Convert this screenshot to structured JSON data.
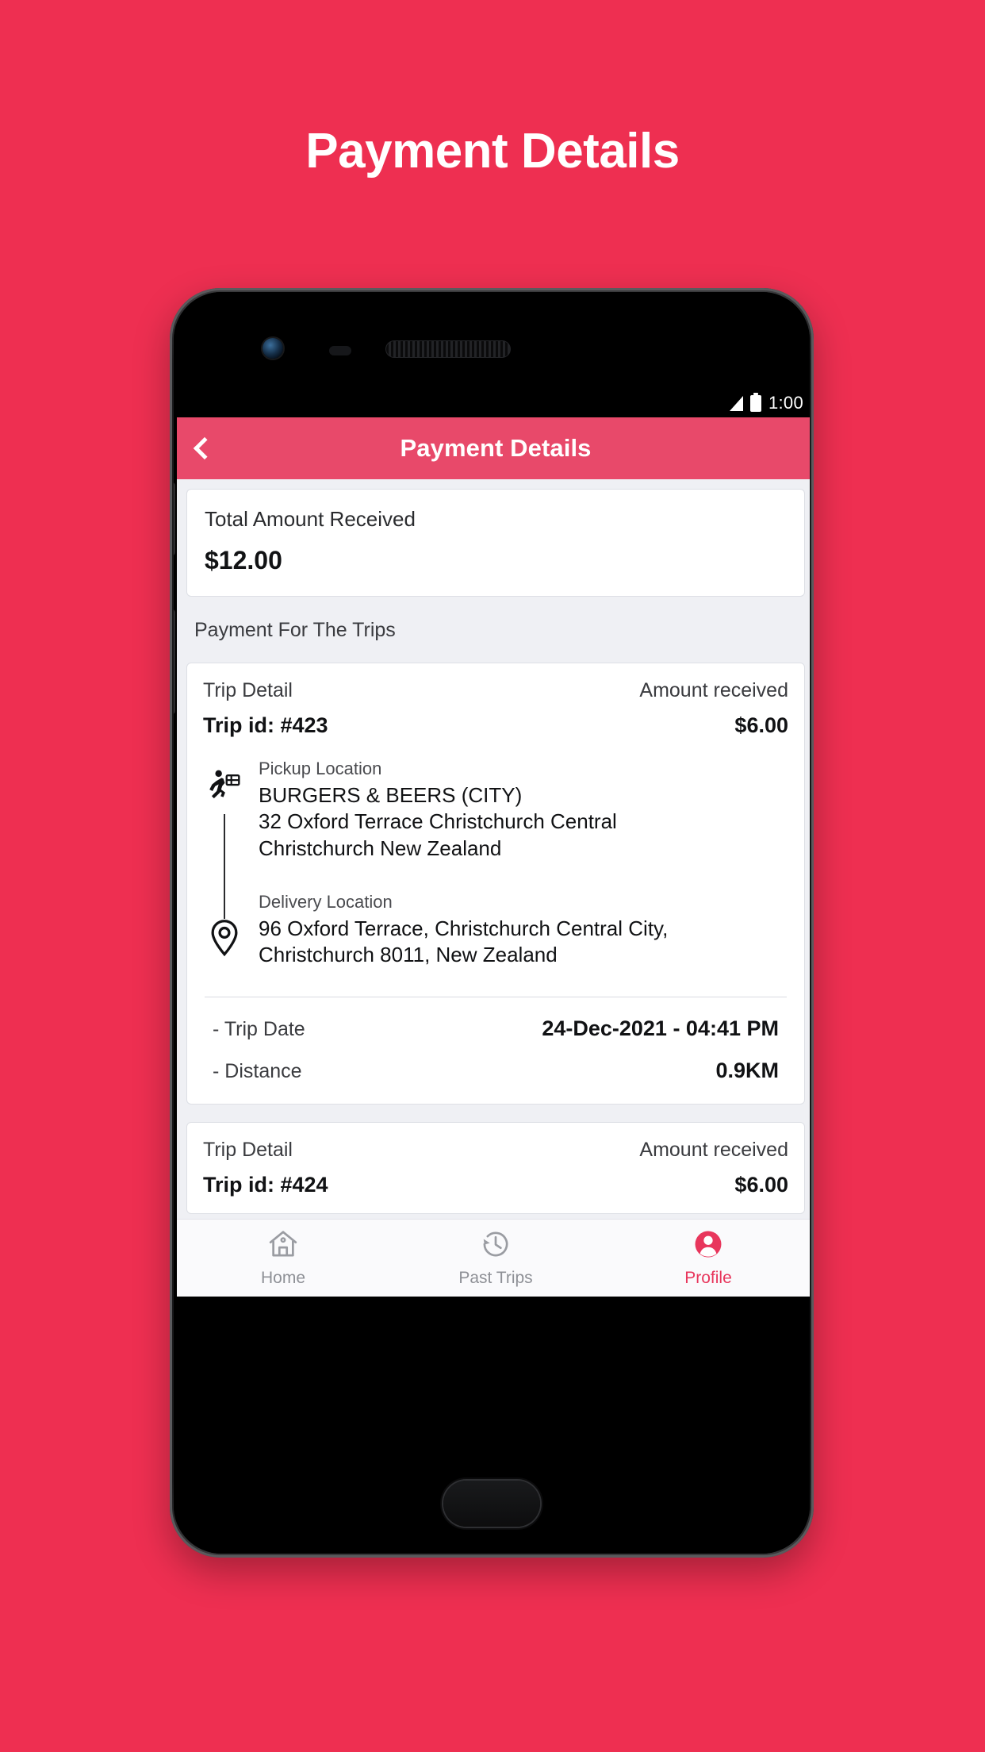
{
  "page": {
    "title": "Payment Details",
    "background_color": "#ee2f51",
    "accent_color": "#e8496a"
  },
  "status_bar": {
    "time": "1:00",
    "signal_icon": "signal-icon",
    "battery_icon": "battery-icon"
  },
  "app_bar": {
    "back_icon": "chevron-left-icon",
    "title": "Payment Details"
  },
  "total": {
    "label": "Total Amount Received",
    "value": "$12.00"
  },
  "section": {
    "label": "Payment For The Trips"
  },
  "trips": [
    {
      "detail_label": "Trip Detail",
      "amount_label": "Amount received",
      "trip_id": "Trip id: #423",
      "amount": "$6.00",
      "pickup": {
        "icon": "courier-running-icon",
        "label": "Pickup Location",
        "name": "BURGERS & BEERS (CITY)",
        "address_line_1": "32 Oxford Terrace  Christchurch Central",
        "address_line_2": "Christchurch  New Zealand"
      },
      "delivery": {
        "icon": "map-pin-icon",
        "label": "Delivery Location",
        "address_line_1": "96 Oxford Terrace, Christchurch Central City,",
        "address_line_2": "Christchurch 8011, New Zealand"
      },
      "trip_date_key": "- Trip Date",
      "trip_date_value": "24-Dec-2021 - 04:41 PM",
      "distance_key": "- Distance",
      "distance_value": "0.9KM"
    },
    {
      "detail_label": "Trip Detail",
      "amount_label": "Amount received",
      "trip_id": "Trip id: #424",
      "amount": "$6.00"
    }
  ],
  "bottom_nav": [
    {
      "label": "Home",
      "icon": "home-icon",
      "active": false
    },
    {
      "label": "Past Trips",
      "icon": "history-clock-icon",
      "active": false
    },
    {
      "label": "Profile",
      "icon": "profile-person-icon",
      "active": true
    }
  ]
}
